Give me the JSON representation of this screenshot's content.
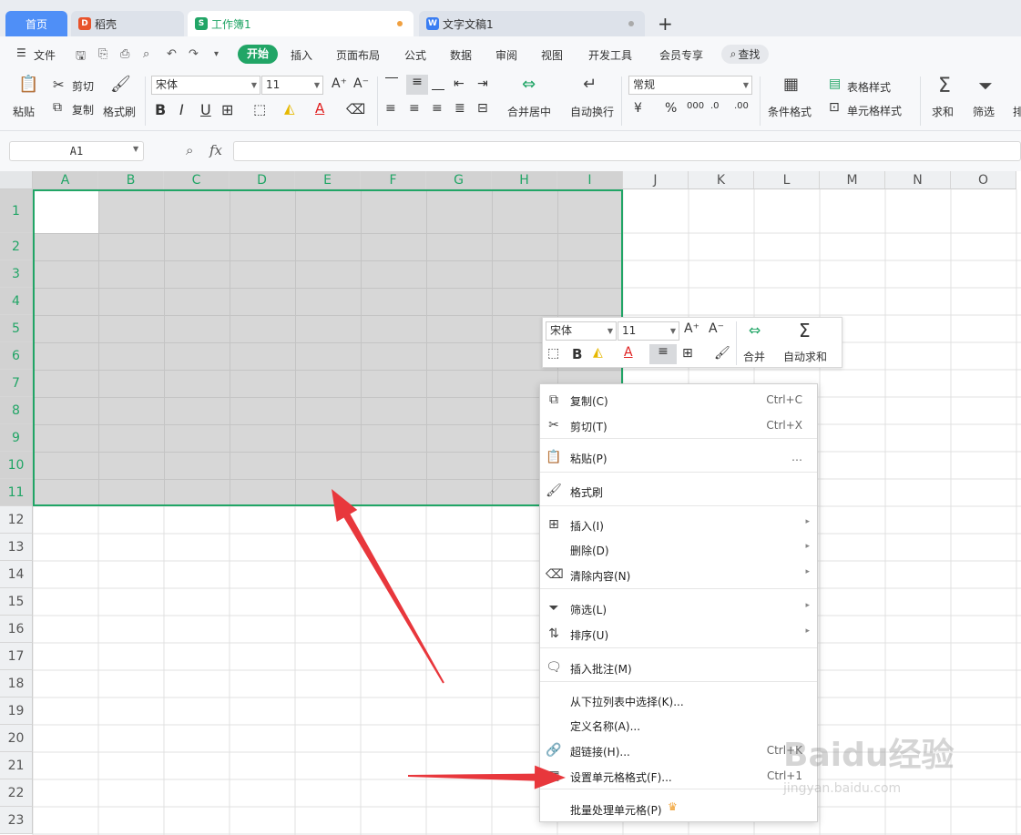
{
  "tabs": [
    {
      "label": "首页"
    },
    {
      "label": "稻壳"
    },
    {
      "label": "工作簿1"
    },
    {
      "label": "文字文稿1"
    }
  ],
  "new_tab": "+",
  "menubar": {
    "file": "文件",
    "items": [
      "开始",
      "插入",
      "页面布局",
      "公式",
      "数据",
      "审阅",
      "视图",
      "开发工具",
      "会员专享"
    ],
    "search": "查找"
  },
  "ribbon": {
    "paste": "粘贴",
    "cut": "剪切",
    "copy": "复制",
    "format_painter": "格式刷",
    "font_name": "宋体",
    "font_size": "11",
    "merge_center": "合并居中",
    "wrap_text": "自动换行",
    "number_format": "常规",
    "conditional_format": "条件格式",
    "table_style": "表格样式",
    "cell_style": "单元格样式",
    "sum": "求和",
    "filter": "筛选",
    "sort_partial": "排"
  },
  "formula_bar": {
    "name_box": "A1",
    "fx": "fx",
    "content": ""
  },
  "grid": {
    "columns": [
      "A",
      "B",
      "C",
      "D",
      "E",
      "F",
      "G",
      "H",
      "I",
      "J",
      "K",
      "L",
      "M",
      "N",
      "O"
    ],
    "rows": [
      "1",
      "2",
      "3",
      "4",
      "5",
      "6",
      "7",
      "8",
      "9",
      "10",
      "11",
      "12",
      "13",
      "14",
      "15",
      "16",
      "17",
      "18",
      "19",
      "20",
      "21",
      "22",
      "23"
    ],
    "selection": "A1:I11"
  },
  "mini_toolbar": {
    "font_name": "宋体",
    "font_size": "11",
    "merge": "合并",
    "auto_sum": "自动求和"
  },
  "context_menu": [
    {
      "icon": "copy-icon",
      "label": "复制(C)",
      "shortcut": "Ctrl+C"
    },
    {
      "icon": "cut-icon",
      "label": "剪切(T)",
      "shortcut": "Ctrl+X"
    },
    {
      "icon": "paste-icon",
      "label": "粘贴(P)",
      "shortcut": "…"
    },
    {
      "icon": "format-painter-icon",
      "label": "格式刷",
      "shortcut": ""
    },
    {
      "icon": "insert-icon",
      "label": "插入(I)",
      "shortcut": ""
    },
    {
      "icon": "",
      "label": "删除(D)",
      "shortcut": ""
    },
    {
      "icon": "clear-icon",
      "label": "清除内容(N)",
      "shortcut": ""
    },
    {
      "icon": "filter-icon",
      "label": "筛选(L)",
      "shortcut": ""
    },
    {
      "icon": "sort-icon",
      "label": "排序(U)",
      "shortcut": ""
    },
    {
      "icon": "comment-icon",
      "label": "插入批注(M)",
      "shortcut": ""
    },
    {
      "icon": "",
      "label": "从下拉列表中选择(K)...",
      "shortcut": ""
    },
    {
      "icon": "",
      "label": "定义名称(A)...",
      "shortcut": ""
    },
    {
      "icon": "link-icon",
      "label": "超链接(H)...",
      "shortcut": "Ctrl+K"
    },
    {
      "icon": "format-cells-icon",
      "label": "设置单元格格式(F)...",
      "shortcut": "Ctrl+1"
    },
    {
      "icon": "",
      "label": "批量处理单元格(P)",
      "shortcut": ""
    }
  ],
  "watermark": {
    "brand": "Baidu经验",
    "url": "jingyan.baidu.com"
  },
  "colors": {
    "accent": "#21a566",
    "arrow": "#e8373c",
    "selection_fill": "#d7d7d7"
  }
}
